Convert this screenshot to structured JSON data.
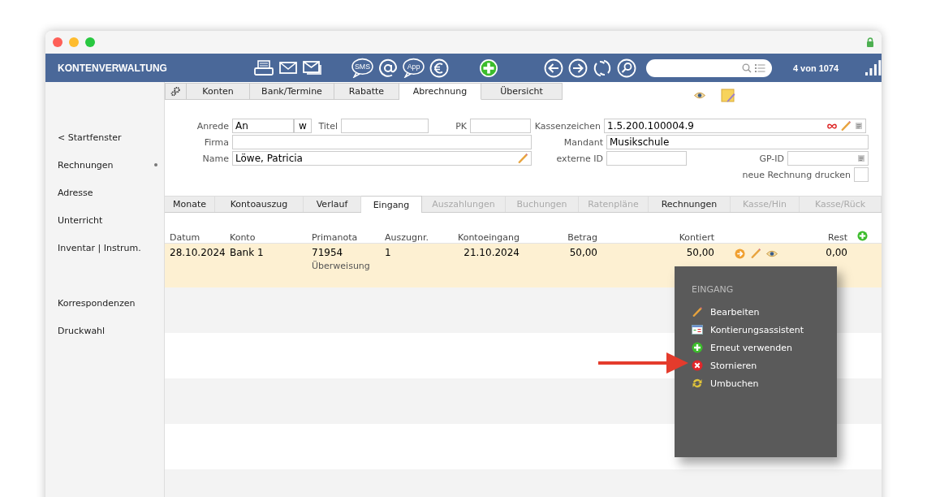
{
  "app_title": "KONTENVERWALTUNG",
  "toolbar": {
    "groups": [
      [
        {
          "kind": "printer"
        },
        {
          "kind": "envelope"
        },
        {
          "kind": "envelopes"
        }
      ],
      [
        {
          "kind": "bubble",
          "label": "SMS"
        },
        {
          "kind": "at"
        },
        {
          "kind": "bubble",
          "label": "App"
        },
        {
          "kind": "euro"
        }
      ],
      [
        {
          "kind": "add"
        }
      ],
      [
        {
          "kind": "back"
        },
        {
          "kind": "forward"
        },
        {
          "kind": "refresh"
        },
        {
          "kind": "search"
        }
      ]
    ]
  },
  "record_counter": "4 von 1074",
  "sidebar": {
    "groups": [
      [
        {
          "label": "< Startfenster",
          "marked": false
        },
        {
          "label": "Rechnungen",
          "marked": true
        },
        {
          "label": "Adresse",
          "marked": false
        },
        {
          "label": "Unterricht",
          "marked": false
        },
        {
          "label": "Inventar | Instrum.",
          "marked": false
        }
      ],
      [
        {
          "label": "Korrespondenzen",
          "marked": false
        },
        {
          "label": "Druckwahl",
          "marked": false
        }
      ]
    ]
  },
  "tabs": [
    {
      "label": "Konten",
      "selected": false
    },
    {
      "label": "Bank/Termine",
      "selected": false
    },
    {
      "label": "Rabatte",
      "selected": false
    },
    {
      "label": "Abrechnung",
      "selected": true
    },
    {
      "label": "Übersicht",
      "selected": false
    }
  ],
  "form": {
    "anrede": {
      "label": "Anrede",
      "value": "An",
      "gender": "w"
    },
    "titel": {
      "label": "Titel"
    },
    "pk": {
      "label": "PK"
    },
    "firma": {
      "label": "Firma"
    },
    "name": {
      "label": "Name",
      "value": "Löwe, Patricia"
    },
    "kassenzeichen": {
      "label": "Kassenzeichen",
      "value": "1.5.200.100004.9"
    },
    "mandant": {
      "label": "Mandant",
      "value": "Musikschule"
    },
    "externe_id": {
      "label": "externe ID"
    },
    "gp_id": {
      "label": "GP-ID"
    },
    "neue_rechnung_drucken": {
      "label": "neue Rechnung drucken",
      "checked": false
    }
  },
  "subtabs": [
    {
      "label": "Monate",
      "selected": false,
      "disabled": false
    },
    {
      "label": "Kontoauszug",
      "selected": false,
      "disabled": false
    },
    {
      "label": "Verlauf",
      "selected": false,
      "disabled": false
    },
    {
      "label": "Eingang",
      "selected": true,
      "disabled": false
    },
    {
      "label": "Auszahlungen",
      "selected": false,
      "disabled": true
    },
    {
      "label": "Buchungen",
      "selected": false,
      "disabled": true
    },
    {
      "label": "Ratenpläne",
      "selected": false,
      "disabled": true
    },
    {
      "label": "Rechnungen",
      "selected": false,
      "disabled": false
    },
    {
      "label": "Kasse/Hin",
      "selected": false,
      "disabled": true
    },
    {
      "label": "Kasse/Rück",
      "selected": false,
      "disabled": true
    }
  ],
  "table": {
    "columns": [
      "Datum",
      "Konto",
      "Primanota",
      "Auszugnr.",
      "Kontoeingang",
      "Betrag",
      "Kontiert",
      "Rest"
    ],
    "rows": [
      {
        "datum": "28.10.2024",
        "konto": "Bank 1",
        "primanota": "71954",
        "primanota_note": "Überweisung",
        "auszugnr": "1",
        "kontoeingang": "21.10.2024",
        "betrag": "50,00",
        "kontiert": "50,00",
        "rest": "0,00",
        "selected": true
      }
    ]
  },
  "context_menu": {
    "title": "EINGANG",
    "items": [
      {
        "kind": "edit",
        "label": "Bearbeiten"
      },
      {
        "kind": "assistant",
        "label": "Kontierungsassistent"
      },
      {
        "kind": "reuse",
        "label": "Erneut verwenden"
      },
      {
        "kind": "cancel",
        "label": "Stornieren"
      },
      {
        "kind": "rebook",
        "label": "Umbuchen"
      }
    ]
  }
}
